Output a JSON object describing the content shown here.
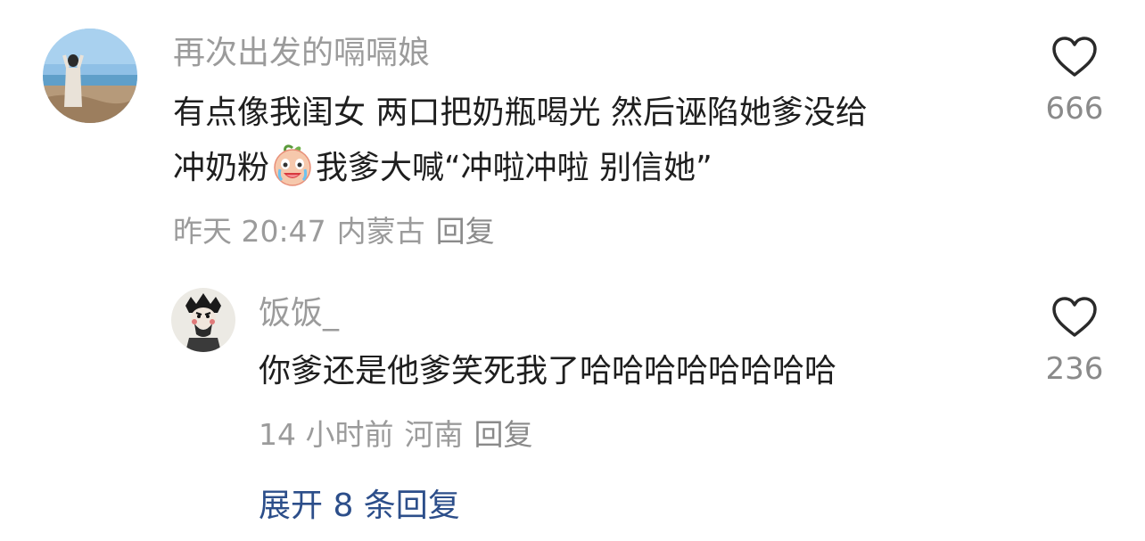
{
  "comment": {
    "username": "再次出发的嗝嗝娘",
    "text_line1": "有点像我闺女 两口把奶瓶喝光 然后诬陷她爹没给",
    "text_line2_before": "冲奶粉",
    "emoji": "crying-laughing-peach-emoji",
    "text_line2_after": "我爹大喊“冲啦冲啦 别信她”",
    "time": "昨天 20:47",
    "location": "内蒙古",
    "reply_label": "回复",
    "like_count": "666"
  },
  "reply": {
    "username": "饭饭_",
    "text": "你爹还是他爹笑死我了哈哈哈哈哈哈哈哈",
    "time": "14 小时前",
    "location": "河南",
    "reply_label": "回复",
    "like_count": "236"
  },
  "expand_label": "展开 8 条回复",
  "colors": {
    "username": "#9b9b9b",
    "text": "#1e1e1e",
    "meta": "#9b9b9b",
    "link": "#2c4e8a"
  }
}
